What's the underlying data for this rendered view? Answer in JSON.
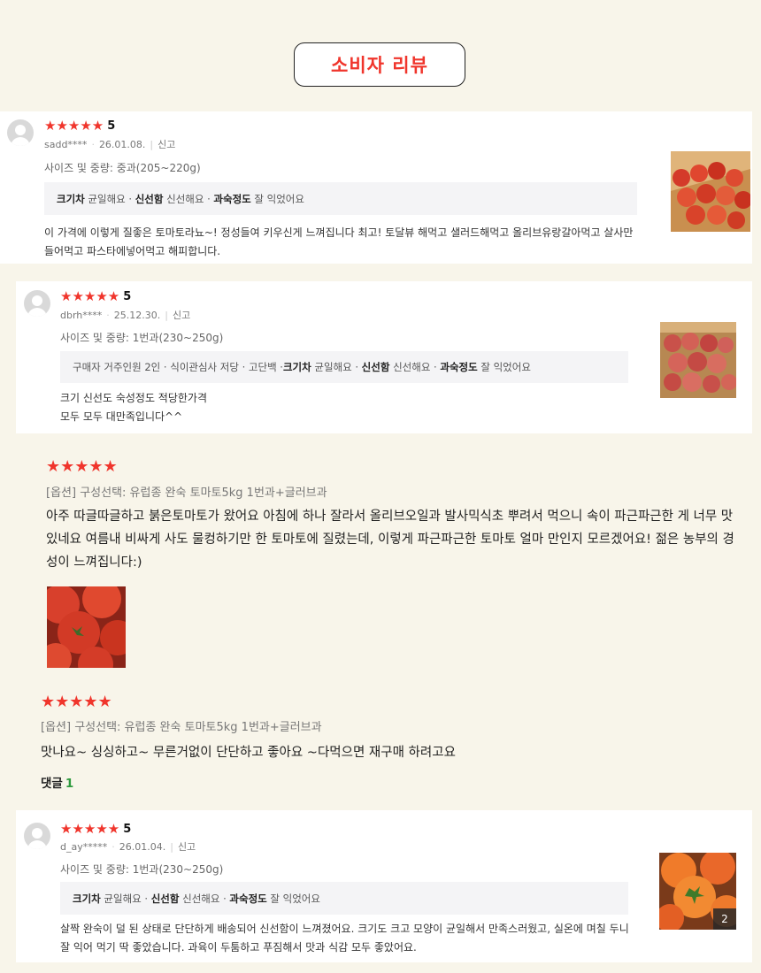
{
  "page_title": "소비자 리뷰",
  "report_label": "신고",
  "score_label": "5",
  "colors": {
    "accent": "#f0352c",
    "background": "#f8f5ea",
    "comment_count": "#2e9a3e"
  },
  "reviews": [
    {
      "user": "sadd****",
      "date": "26.01.08.",
      "size_weight": "사이즈 및 중량: 중과(205~220g)",
      "tags": [
        {
          "k": "크기차",
          "v": "균일해요"
        },
        {
          "k": "신선함",
          "v": "신선해요"
        },
        {
          "k": "과숙정도",
          "v": "잘 익었어요"
        }
      ],
      "text": "이 가격에 이렇게 질좋은 토마토라뇨~! 정성들여 키우신게 느껴집니다 최고! 토달뷰 해먹고 샐러드해먹고 올리브유랑갈아먹고 살사만들어먹고 파스타에넣어먹고 해피합니다."
    },
    {
      "user": "dbrh****",
      "date": "25.12.30.",
      "size_weight": "사이즈 및 중량: 1번과(230~250g)",
      "tag_prefix": "구매자 거주인원 2인 · 식이관심사 저당 · 고단백 · ",
      "tags": [
        {
          "k": "크기차",
          "v": "균일해요"
        },
        {
          "k": "신선함",
          "v": "신선해요"
        },
        {
          "k": "과숙정도",
          "v": "잘 익었어요"
        }
      ],
      "text_lines": [
        "크기 신선도 숙성정도 적당한가격",
        "모두 모두 대만족입니다^^"
      ]
    },
    {
      "option": "[옵션] 구성선택: 유럽종 완숙 토마토5kg 1번과+글러브과",
      "text": "아주 따글따글하고 붉은토마토가 왔어요 아침에 하나 잘라서 올리브오일과 발사믹식초 뿌려서 먹으니 속이 파근파근한 게 너무 맛있네요 여름내 비싸게 사도 물컹하기만 한 토마토에 질렸는데, 이렇게 파근파근한 토마토 얼마 만인지 모르겠어요! 젊은 농부의 경성이 느껴집니다:)"
    },
    {
      "option": "[옵션] 구성선택: 유럽종 완숙 토마토5kg 1번과+글러브과",
      "text": "맛나요~ 싱싱하고~ 무른거없이 단단하고 좋아요 ~다먹으면 재구매 하려고요",
      "comment_label": "댓글",
      "comment_count": "1"
    },
    {
      "user": "d_ay*****",
      "date": "26.01.04.",
      "size_weight": "사이즈 및 중량: 1번과(230~250g)",
      "tags": [
        {
          "k": "크기차",
          "v": "균일해요"
        },
        {
          "k": "신선함",
          "v": "신선해요"
        },
        {
          "k": "과숙정도",
          "v": "잘 익었어요"
        }
      ],
      "text": "살짝 완숙이 덜 된 상태로 단단하게 배송되어 신선함이 느껴졌어요. 크기도 크고 모양이 균일해서 만족스러웠고, 실온에 며칠 두니 잘 익어 먹기 딱 좋았습니다. 과육이 두툼하고 푸짐해서 맛과 식감 모두 좋았어요.",
      "photo_count": "2"
    }
  ]
}
